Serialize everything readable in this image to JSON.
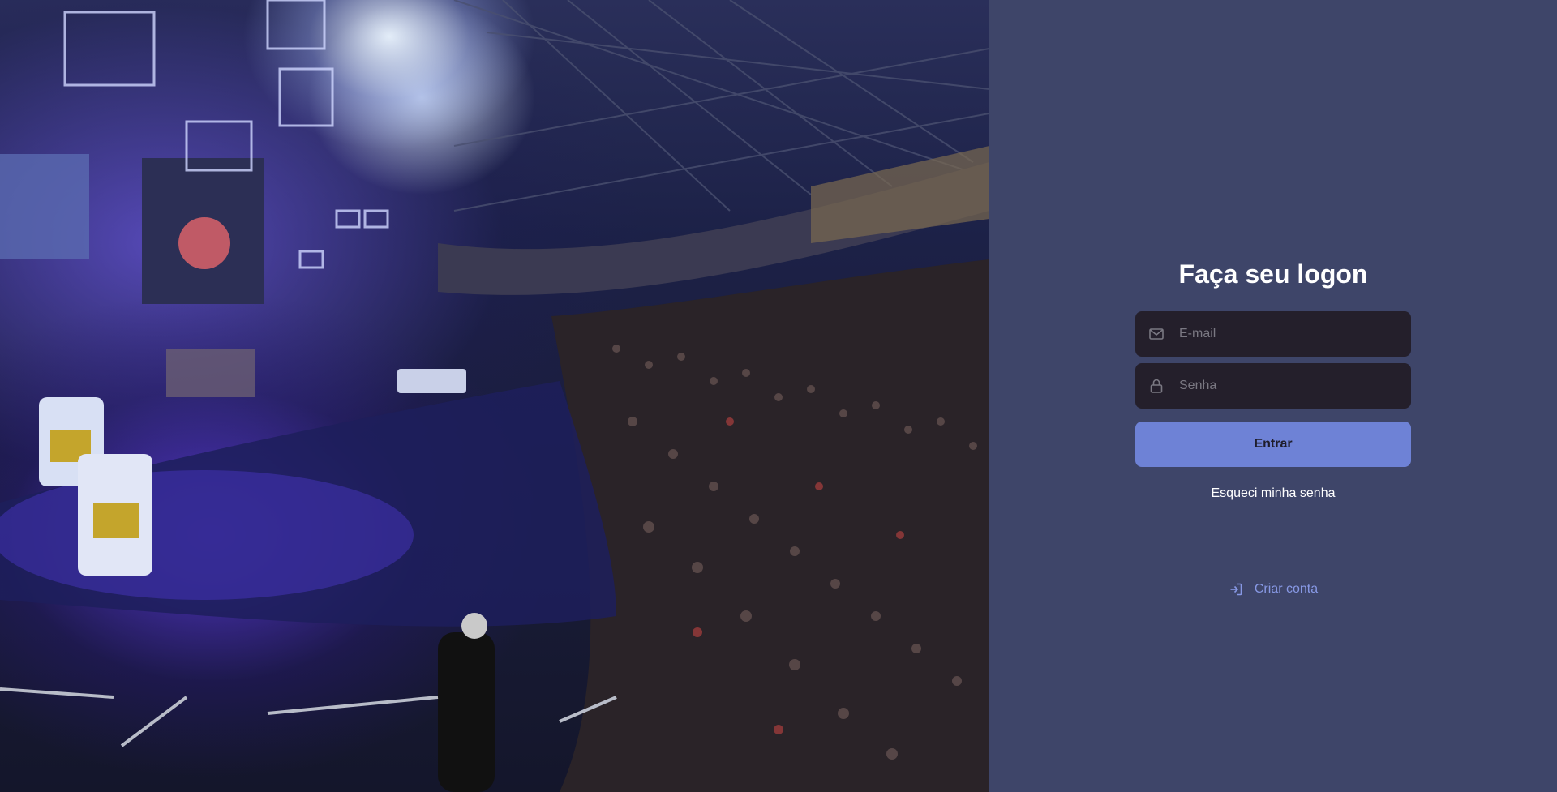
{
  "login": {
    "title": "Faça seu logon",
    "email_placeholder": "E-mail",
    "password_placeholder": "Senha",
    "submit_label": "Entrar",
    "forgot_label": "Esqueci minha senha",
    "signup_label": "Criar conta"
  },
  "icons": {
    "email": "mail-icon",
    "password": "lock-icon",
    "signup": "log-in-icon"
  },
  "colors": {
    "panel_bg": "#3e4569",
    "input_bg": "#241f2b",
    "button_bg": "#6e82d6",
    "link_accent": "#8798e4",
    "text_white": "#ffffff"
  }
}
